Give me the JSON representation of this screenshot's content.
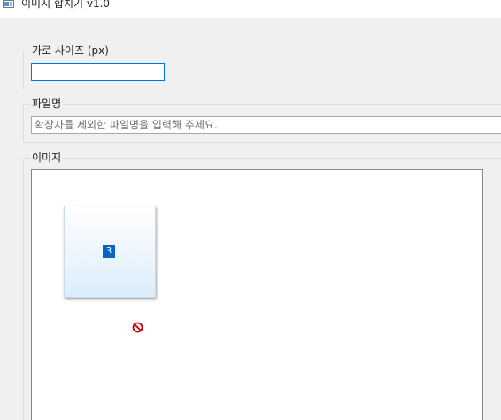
{
  "window": {
    "title": "이미지 합치기 v1.0",
    "icon": "app-window-icon"
  },
  "width_group": {
    "legend": "가로 사이즈 (px)",
    "value": "",
    "placeholder": ""
  },
  "filename_group": {
    "legend": "파일명",
    "value": "",
    "placeholder": "확장자를 제외한 파일명을 입력해 주세요."
  },
  "image_group": {
    "legend": "이미지",
    "drag": {
      "count": "3",
      "cursor_icon": "no-drop-icon"
    }
  },
  "colors": {
    "accent": "#0078d7",
    "badge": "#0a64c8",
    "no_drop": "#c00000"
  }
}
